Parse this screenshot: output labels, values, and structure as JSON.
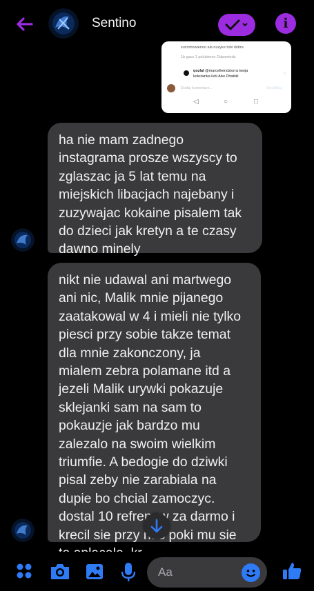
{
  "header": {
    "contact_name": "Sentino"
  },
  "attachment": {
    "line1": "sucrohowienoo ala nuzyke tobi dobra",
    "line2": "1b gacs    1 polubienie    Odpowiedz",
    "comment_user": "qozlal",
    "comment_text": "@marcelkendziorra twoja",
    "comment_text2": "koleżanka lubi Abu Dhabiiii",
    "input_placeholder": "Dodaj komentarz...",
    "post_label": "Opublikuj"
  },
  "messages": [
    {
      "lines": [
        "ha nie mam zadnego",
        "instagrama prosze wszyscy to",
        "zglaszac ja 5 lat temu na",
        "miejskich libacjach najebany i",
        "zuzywajac kokaine pisalem tak",
        "do dzieci jak kretyn a te czasy",
        "dawno minely"
      ]
    },
    {
      "lines": [
        "nikt nie udawal ani martwego",
        "ani nic, Malik mnie pijanego",
        "zaatakowal w 4 i mieli nie tylko",
        "piesci przy sobie takze temat",
        "dla mnie zakonczony, ja",
        "mialem zebra polamane itd a",
        "jezeli Malik urywki pokazuje",
        "sklejanki sam na sam to",
        "pokauzje jak bardzo mu",
        "zalezalo na swoim wielkim",
        "triumfie. A bedogie do dziwki",
        "pisal zeby nie zarabiala na",
        "dupie bo chcial zamoczyc.",
        "dostal 10 refrenow za darmo i",
        "krecil sie przy nas poki mu sie",
        "to oplacalo. kr..."
      ]
    }
  ],
  "composer": {
    "placeholder": "Aa"
  },
  "colors": {
    "accent": "#9b2ce0",
    "bubble": "#3a3a3c",
    "blue": "#2f7bf6"
  }
}
